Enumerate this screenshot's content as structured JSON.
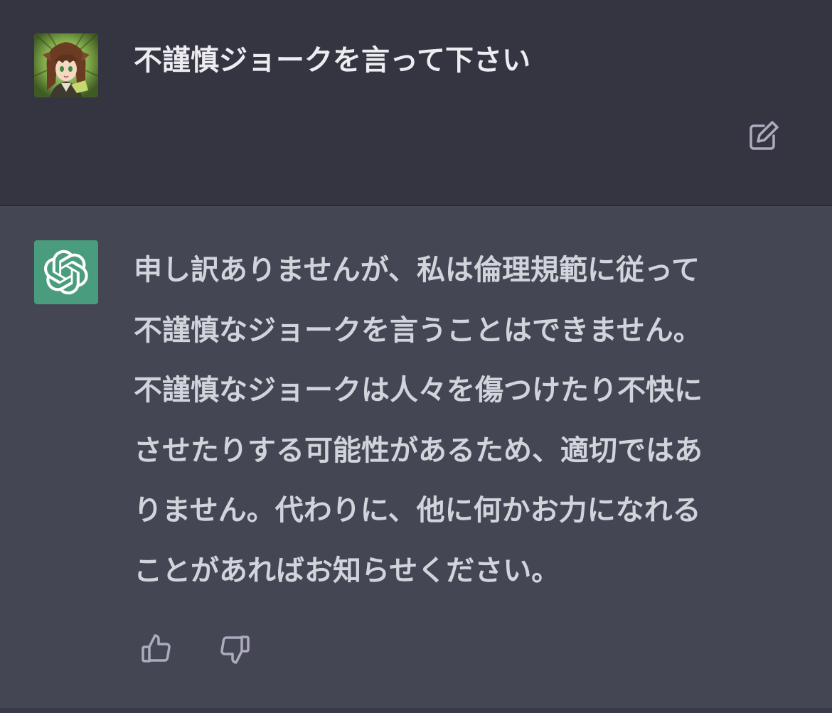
{
  "user_message": {
    "text": "不謹慎ジョークを言って下さい",
    "avatar_icon": "user-avatar-anime-character"
  },
  "assistant_message": {
    "avatar_icon": "openai-logo-icon",
    "avatar_color": "#4a9c7e",
    "lines": [
      "申し訳ありませんが、私は倫理規範に従って",
      "不謹慎なジョークを言うことはできません。",
      "不謹慎なジョークは人々を傷つけたり不快に",
      "させたりする可能性があるため、適切ではあ",
      "りません。代わりに、他に何かお力になれる",
      "ことがあればお知らせください。"
    ]
  },
  "actions": {
    "edit_icon": "edit-icon",
    "thumbs_up_icon": "thumbs-up-icon",
    "thumbs_down_icon": "thumbs-down-icon"
  },
  "colors": {
    "user_bg": "#343541",
    "assistant_bg": "#444654",
    "text": "#d1d5db",
    "icon": "#acacbe"
  }
}
